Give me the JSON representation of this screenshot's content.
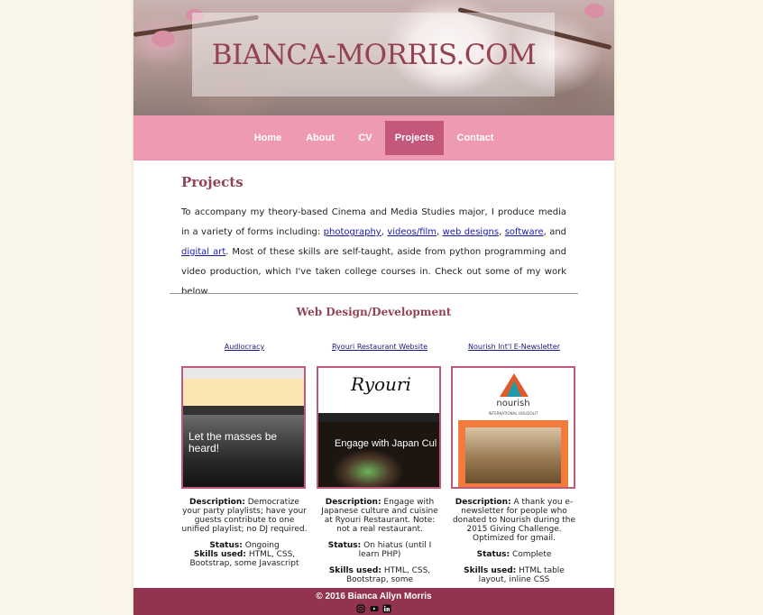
{
  "site": {
    "title": "BIANCA-MORRIS.COM"
  },
  "nav": [
    {
      "label": "Home"
    },
    {
      "label": "About"
    },
    {
      "label": "CV"
    },
    {
      "label": "Projects",
      "active": true
    },
    {
      "label": "Contact"
    }
  ],
  "page": {
    "heading": "Projects",
    "intro": {
      "t1": "To accompany my theory-based Cinema and Media Studies major, I produce media in a variety of forms including: ",
      "l1": "photography",
      "t2": ", ",
      "l2": "videos/film",
      "t3": ", ",
      "l3": "web designs",
      "t4": ", ",
      "l4": "software",
      "t5": ", and ",
      "l5": "digital art",
      "t6": ". Most of these skills are self-taught, aside from python programming and video production, which I've taken college courses in. Check out some of my work below."
    },
    "section_heading": "Web Design/Development"
  },
  "projects": [
    {
      "title": "Audiocracy",
      "thumb_text": "Let the masses be heard!",
      "description_label": "Description:",
      "description": "Democratize your party playlists; have your guests contribute to one unified playlist; no DJ required.",
      "status_label": "Status:",
      "status": "Ongoing",
      "skills_label": "Skills used:",
      "skills": "HTML, CSS, Bootstrap, some Javascript"
    },
    {
      "title": "Ryouri Restaurant Website",
      "thumb_text": "Engage with Japan Cul",
      "thumb_logo": "Ryouri",
      "description_label": "Description:",
      "description": "Engage with Japanese culture and cuisine at Ryouri Restaurant. Note: not a real restaurant.",
      "status_label": "Status:",
      "status": "On hiatus (until I learn PHP)",
      "skills_label": "Skills used:",
      "skills": "HTML, CSS, Bootstrap, some"
    },
    {
      "title": "Nourish Int'l E-Newsletter",
      "thumb_logo": "nourish",
      "thumb_sub": "INTERNATIONAL HOLIDOLIT",
      "description_label": "Description:",
      "description": "A thank you e-newsletter for people who donated to Nourish during the 2015 Giving Challenge. Optimized for gmail.",
      "status_label": "Status:",
      "status": "Complete",
      "skills_label": "Skills used:",
      "skills": "HTML table layout, inline CSS"
    }
  ],
  "footer": {
    "copyright": "© 2016 Bianca Allyn Morris",
    "icons": [
      "instagram-icon",
      "youtube-icon",
      "linkedin-icon"
    ]
  },
  "colors": {
    "accent": "#924457",
    "nav_bg": "#ef9ab3",
    "nav_active": "#c4587a",
    "footer_bg": "#92334f"
  }
}
